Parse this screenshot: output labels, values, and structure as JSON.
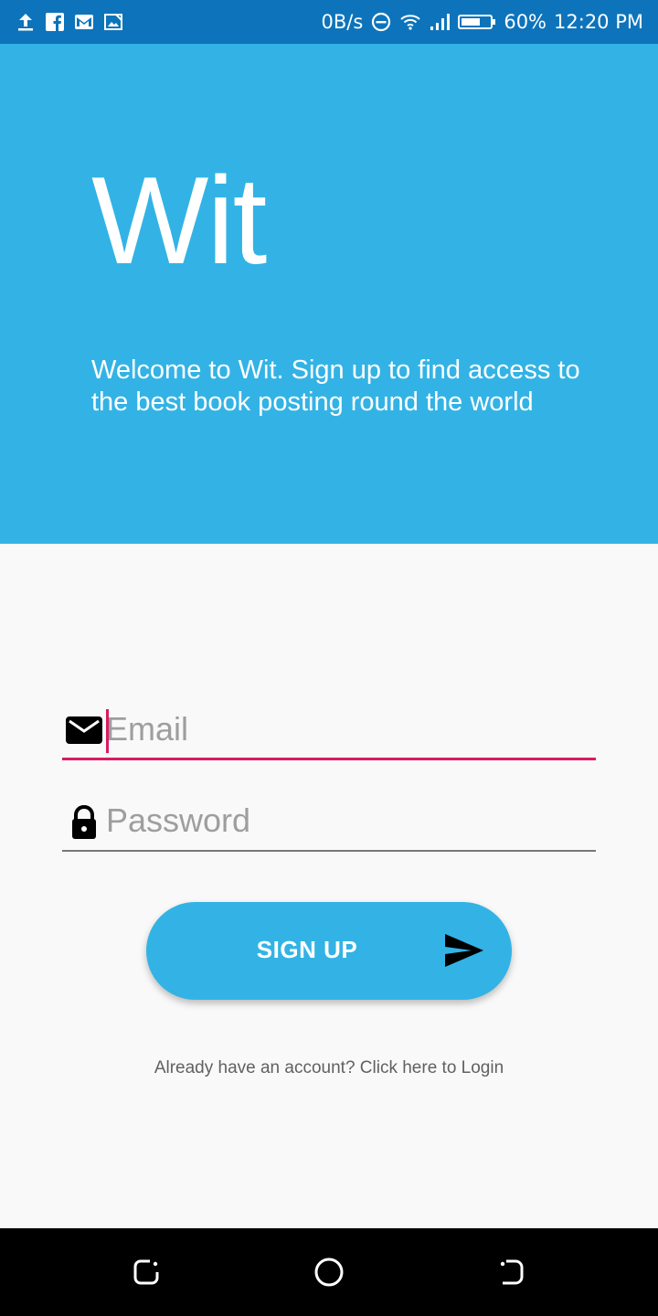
{
  "status_bar": {
    "left_icons": [
      "upload-icon",
      "facebook-icon",
      "gmail-icon",
      "screenshot-icon"
    ],
    "net_speed": "0B/s",
    "right_icons": [
      "do-not-disturb-icon",
      "wifi-icon",
      "signal-icon",
      "battery-icon"
    ],
    "battery_percent": "60%",
    "time": "12:20 PM"
  },
  "hero": {
    "title": "Wit",
    "tagline": "Welcome to Wit. Sign up to find access to the best book posting round the world"
  },
  "form": {
    "email": {
      "placeholder": "Email",
      "value": "",
      "icon": "mail-icon"
    },
    "password": {
      "placeholder": "Password",
      "value": "",
      "icon": "lock-icon"
    },
    "signup_button": {
      "label": "SIGN UP",
      "icon": "send-icon"
    },
    "login_link": "Already have an account? Click here to Login"
  },
  "nav_bar": {
    "items": [
      "recents-icon",
      "home-icon",
      "back-icon"
    ]
  },
  "colors": {
    "primary": "#33b3e5",
    "status_bar": "#0d74bb",
    "accent": "#d81b60",
    "background": "#f9f9f9"
  }
}
